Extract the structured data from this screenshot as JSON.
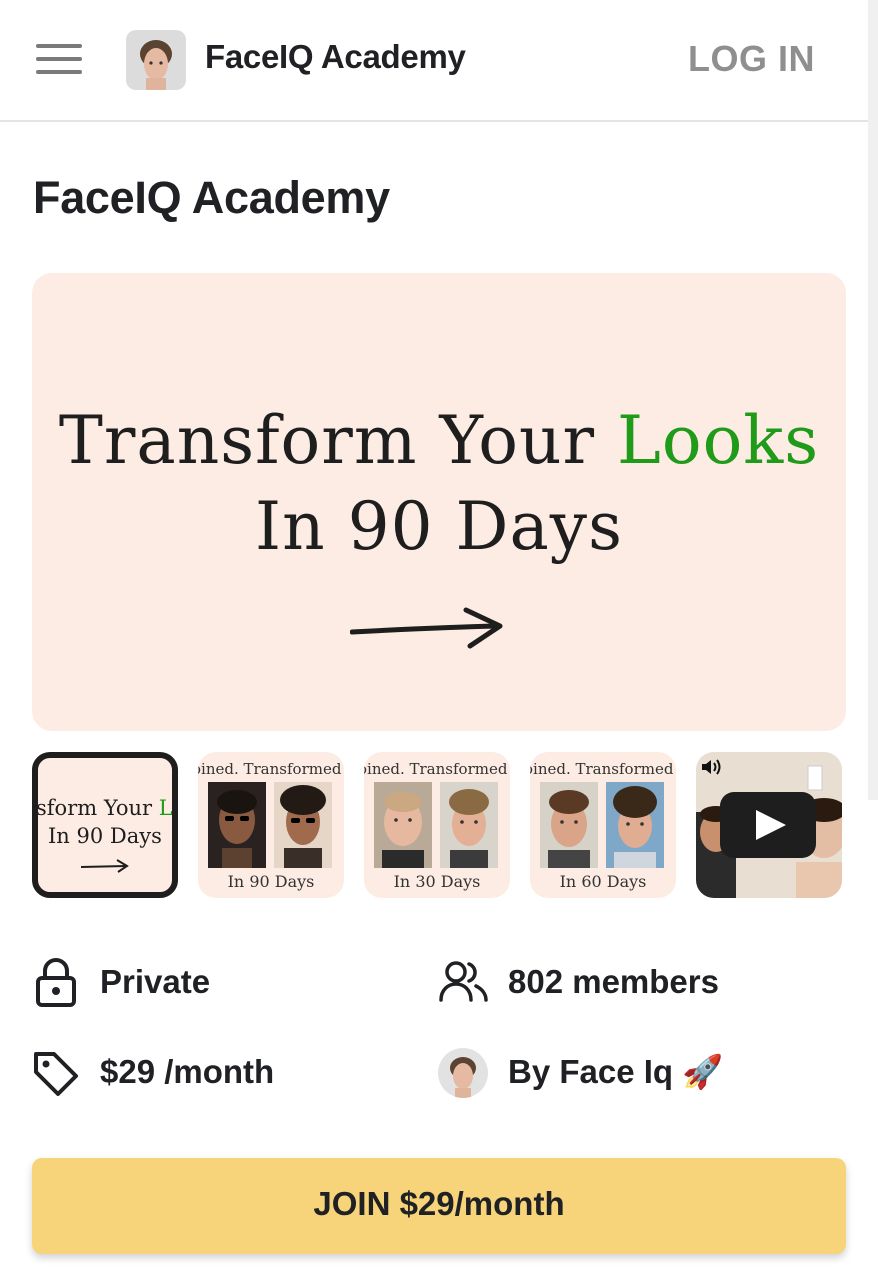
{
  "header": {
    "brand": "FaceIQ Academy",
    "login_label": "LOG IN",
    "menu_icon": "hamburger-menu-icon",
    "logo_icon": "face-portrait-logo"
  },
  "page": {
    "title": "FaceIQ Academy"
  },
  "hero": {
    "line1_prefix": "Transform Your ",
    "line1_accent": "Looks",
    "line2": "In 90 Days",
    "arrow_icon": "arrow-right-icon",
    "accent_color": "#1f9a19",
    "background_color": "#fdece3"
  },
  "thumbnails": [
    {
      "kind": "slide",
      "line1": "sform Your L",
      "line2": "In 90 Days",
      "selected": true
    },
    {
      "kind": "transformation",
      "caption": "oined. Transformed",
      "footer": "In 90 Days"
    },
    {
      "kind": "transformation",
      "caption": "oined. Transformed",
      "footer": "In 30 Days"
    },
    {
      "kind": "transformation",
      "caption": "oined. Transformed",
      "footer": "In 60 Days"
    },
    {
      "kind": "video",
      "icons": [
        "volume-icon",
        "play-icon"
      ]
    }
  ],
  "info": {
    "privacy": {
      "icon": "lock-icon",
      "text": "Private"
    },
    "members": {
      "icon": "users-icon",
      "text": "802 members"
    },
    "price": {
      "icon": "price-tag-icon",
      "text": "$29 /month"
    },
    "owner": {
      "icon": "owner-avatar",
      "text": "By Face Iq 🚀"
    }
  },
  "join_button": {
    "label": "JOIN $29/month",
    "color": "#f7d479"
  }
}
